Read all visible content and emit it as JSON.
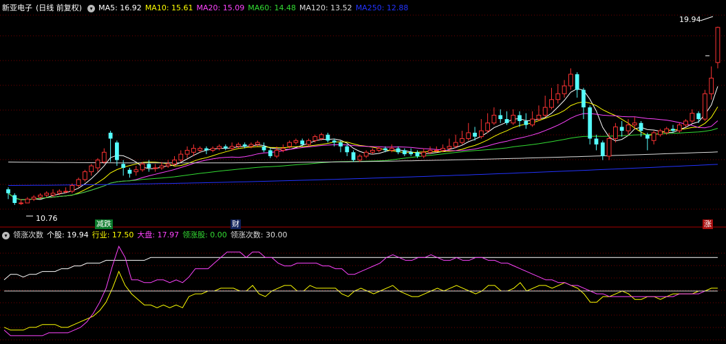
{
  "stock_name": "新亚电子",
  "period_label": "(日线 前复权)",
  "ma_legend": [
    {
      "label": "MA5: 16.92",
      "color": "#ffffff"
    },
    {
      "label": "MA10: 15.61",
      "color": "#ffff00"
    },
    {
      "label": "MA20: 15.09",
      "color": "#ff44ff"
    },
    {
      "label": "MA60: 14.48",
      "color": "#33dd33"
    },
    {
      "label": "MA120: 13.52",
      "color": "#dddddd"
    },
    {
      "label": "MA250: 12.88",
      "color": "#2233ff"
    }
  ],
  "indicator_legend": [
    {
      "label": "领涨次数",
      "color": "#dddddd"
    },
    {
      "label": "个股: 19.94",
      "color": "#ffffff"
    },
    {
      "label": "行业: 17.50",
      "color": "#ffff00"
    },
    {
      "label": "大盘: 17.97",
      "color": "#ff44ff"
    },
    {
      "label": "领涨股: 0.00",
      "color": "#33dd33"
    },
    {
      "label": "领涨次数: 30.00",
      "color": "#dddddd"
    }
  ],
  "markers": {
    "high": "19.94",
    "low": "10.76",
    "event1": "减跌",
    "event2": "财",
    "event3": "涨"
  },
  "colors": {
    "up": "#ff3333",
    "down": "#55ffff",
    "grid": "#7a0000"
  },
  "chart_data": [
    {
      "type": "candlestick",
      "ylim": [
        10.3,
        20.6
      ],
      "series": [
        {
          "name": "K",
          "ohlc": [
            [
              11.6,
              11.4,
              11.7,
              11.1
            ],
            [
              11.3,
              10.9,
              11.4,
              10.8
            ],
            [
              10.9,
              10.9,
              11.1,
              10.8
            ],
            [
              10.9,
              11.1,
              11.2,
              10.9
            ],
            [
              11.1,
              11.2,
              11.3,
              11.0
            ],
            [
              11.2,
              11.3,
              11.4,
              11.1
            ],
            [
              11.3,
              11.4,
              11.5,
              11.2
            ],
            [
              11.3,
              11.4,
              11.6,
              11.2
            ],
            [
              11.4,
              11.5,
              11.6,
              11.3
            ],
            [
              11.5,
              11.5,
              11.7,
              11.4
            ],
            [
              11.5,
              11.8,
              11.9,
              11.4
            ],
            [
              11.8,
              12.1,
              12.2,
              11.7
            ],
            [
              12.1,
              12.5,
              12.6,
              12.0
            ],
            [
              12.5,
              12.8,
              12.9,
              12.3
            ],
            [
              12.7,
              13.1,
              13.2,
              12.5
            ],
            [
              13.0,
              13.5,
              13.7,
              12.9
            ],
            [
              14.5,
              14.2,
              14.6,
              13.0
            ],
            [
              14.0,
              13.1,
              14.1,
              12.8
            ],
            [
              12.9,
              12.7,
              13.1,
              12.3
            ],
            [
              12.6,
              12.4,
              12.7,
              12.2
            ],
            [
              12.5,
              12.6,
              12.8,
              12.3
            ],
            [
              12.6,
              12.9,
              13.0,
              12.5
            ],
            [
              12.9,
              12.7,
              13.1,
              12.5
            ],
            [
              12.7,
              12.7,
              12.9,
              12.5
            ],
            [
              12.7,
              12.8,
              13.0,
              12.6
            ],
            [
              12.8,
              12.9,
              13.1,
              12.7
            ],
            [
              12.9,
              13.1,
              13.3,
              12.8
            ],
            [
              13.1,
              13.4,
              13.6,
              13.0
            ],
            [
              13.4,
              13.6,
              13.8,
              13.2
            ],
            [
              13.5,
              13.7,
              13.9,
              13.3
            ],
            [
              13.6,
              13.7,
              13.8,
              13.5
            ],
            [
              13.7,
              13.6,
              13.8,
              13.4
            ],
            [
              13.6,
              13.7,
              13.8,
              13.5
            ],
            [
              13.7,
              13.8,
              13.9,
              13.6
            ],
            [
              13.8,
              13.7,
              13.9,
              13.6
            ],
            [
              13.7,
              13.8,
              14.0,
              13.6
            ],
            [
              13.8,
              13.9,
              14.0,
              13.7
            ],
            [
              13.9,
              13.8,
              14.0,
              13.7
            ],
            [
              13.8,
              13.9,
              14.0,
              13.7
            ],
            [
              13.9,
              14.0,
              14.1,
              13.8
            ],
            [
              13.8,
              13.6,
              14.0,
              13.5
            ],
            [
              13.6,
              13.3,
              13.7,
              13.2
            ],
            [
              13.3,
              13.6,
              13.8,
              13.2
            ],
            [
              13.6,
              13.7,
              13.9,
              13.5
            ],
            [
              13.8,
              14.0,
              14.1,
              13.7
            ],
            [
              14.0,
              14.1,
              14.2,
              13.9
            ],
            [
              14.1,
              13.9,
              14.2,
              13.8
            ],
            [
              13.9,
              14.1,
              14.2,
              13.8
            ],
            [
              14.1,
              14.3,
              14.4,
              14.0
            ],
            [
              14.2,
              14.4,
              14.5,
              14.1
            ],
            [
              14.4,
              14.1,
              14.5,
              14.0
            ],
            [
              14.1,
              14.0,
              14.2,
              13.8
            ],
            [
              14.0,
              13.8,
              14.1,
              13.5
            ],
            [
              13.8,
              13.5,
              13.9,
              13.3
            ],
            [
              13.5,
              13.1,
              13.6,
              13.0
            ],
            [
              13.1,
              13.3,
              13.4,
              13.0
            ],
            [
              13.3,
              13.5,
              13.6,
              13.2
            ],
            [
              13.5,
              13.6,
              13.7,
              13.4
            ],
            [
              13.6,
              13.7,
              13.8,
              13.5
            ],
            [
              13.7,
              13.6,
              13.8,
              13.5
            ],
            [
              13.6,
              13.7,
              13.9,
              13.5
            ],
            [
              13.7,
              13.5,
              13.8,
              13.4
            ],
            [
              13.6,
              13.4,
              13.7,
              13.3
            ],
            [
              13.5,
              13.4,
              13.7,
              13.3
            ],
            [
              13.5,
              13.3,
              13.6,
              13.2
            ],
            [
              13.3,
              13.5,
              13.7,
              13.2
            ],
            [
              13.5,
              13.6,
              13.8,
              13.4
            ],
            [
              13.6,
              13.6,
              13.8,
              13.5
            ],
            [
              13.6,
              13.7,
              13.9,
              13.5
            ],
            [
              13.7,
              13.8,
              14.2,
              13.6
            ],
            [
              13.8,
              14.0,
              14.4,
              13.7
            ],
            [
              14.0,
              14.2,
              14.6,
              13.9
            ],
            [
              14.2,
              14.5,
              15.0,
              14.1
            ],
            [
              14.5,
              14.3,
              14.8,
              14.1
            ],
            [
              14.3,
              14.6,
              15.2,
              14.2
            ],
            [
              14.6,
              15.0,
              15.5,
              14.5
            ],
            [
              15.0,
              15.4,
              15.8,
              14.9
            ],
            [
              15.4,
              15.2,
              15.7,
              15.0
            ],
            [
              15.2,
              15.0,
              15.6,
              14.9
            ],
            [
              15.0,
              15.4,
              15.7,
              14.9
            ],
            [
              15.4,
              15.1,
              15.6,
              14.8
            ],
            [
              15.1,
              14.9,
              15.5,
              14.7
            ],
            [
              14.9,
              15.2,
              15.6,
              14.8
            ],
            [
              15.2,
              15.4,
              15.9,
              15.1
            ],
            [
              15.4,
              15.8,
              16.4,
              15.3
            ],
            [
              15.8,
              16.2,
              16.8,
              15.7
            ],
            [
              16.2,
              16.5,
              17.0,
              16.0
            ],
            [
              16.5,
              16.9,
              17.2,
              16.3
            ],
            [
              16.9,
              17.5,
              17.8,
              16.7
            ],
            [
              17.5,
              16.7,
              17.6,
              16.3
            ],
            [
              16.7,
              15.8,
              16.8,
              15.2
            ],
            [
              15.8,
              14.2,
              15.9,
              13.9
            ],
            [
              14.2,
              13.9,
              14.4,
              13.6
            ],
            [
              14.0,
              13.3,
              14.1,
              13.1
            ],
            [
              13.3,
              14.2,
              14.5,
              13.1
            ],
            [
              14.2,
              14.8,
              15.0,
              14.0
            ],
            [
              14.8,
              14.6,
              15.1,
              14.3
            ],
            [
              14.6,
              14.9,
              15.2,
              14.4
            ],
            [
              14.9,
              15.0,
              15.3,
              14.7
            ],
            [
              15.0,
              14.6,
              15.1,
              14.3
            ],
            [
              14.4,
              14.2,
              14.5,
              13.6
            ],
            [
              14.1,
              14.5,
              14.6,
              13.9
            ],
            [
              14.4,
              14.6,
              14.7,
              14.3
            ],
            [
              14.5,
              14.7,
              14.8,
              14.4
            ],
            [
              14.7,
              14.6,
              14.9,
              14.5
            ],
            [
              14.6,
              14.9,
              15.0,
              14.5
            ],
            [
              14.9,
              15.1,
              15.2,
              14.8
            ],
            [
              15.1,
              15.5,
              15.7,
              15.0
            ],
            [
              15.5,
              15.2,
              15.6,
              15.0
            ],
            [
              15.2,
              16.5,
              16.7,
              15.1
            ],
            [
              16.5,
              17.3,
              17.9,
              16.2
            ],
            [
              18.1,
              19.9,
              19.94,
              17.8
            ]
          ]
        }
      ],
      "ma_periods": [
        5,
        10,
        20,
        60,
        120,
        250
      ],
      "ma_values_last": [
        16.92,
        15.61,
        15.09,
        14.48,
        13.52,
        12.88
      ]
    },
    {
      "type": "line",
      "title": "领涨次数",
      "series": [
        {
          "name": "个股",
          "values": [
            22,
            24,
            24,
            23,
            24,
            24,
            25,
            25,
            25,
            26,
            26,
            27,
            27,
            28,
            28,
            28,
            29,
            29,
            29,
            29,
            29,
            29,
            29,
            30,
            30,
            30,
            30,
            30,
            30,
            30,
            30,
            30,
            30,
            30,
            30,
            30,
            30,
            30,
            30,
            30,
            30,
            30,
            30,
            30,
            30,
            30,
            30,
            30,
            30,
            30,
            30,
            30,
            30,
            30,
            30,
            30,
            30,
            30,
            30,
            30,
            30,
            30,
            30,
            30,
            30,
            30,
            30,
            30,
            30,
            30,
            30,
            30,
            30,
            30,
            30,
            30,
            30,
            30,
            30,
            30,
            30,
            30,
            30,
            30,
            30,
            30,
            30,
            30,
            30,
            30,
            30,
            30,
            30,
            30,
            30,
            30,
            30,
            30,
            30,
            30,
            30,
            30,
            30,
            30,
            30,
            30,
            30,
            30,
            30,
            30,
            30,
            30,
            30
          ]
        },
        {
          "name": "行业",
          "values": [
            5,
            4,
            4,
            4,
            5,
            5,
            6,
            6,
            6,
            5,
            5,
            6,
            7,
            8,
            9,
            11,
            14,
            19,
            25,
            20,
            17,
            15,
            13,
            13,
            12,
            13,
            12,
            13,
            12,
            16,
            17,
            17,
            18,
            18,
            19,
            19,
            19,
            18,
            18,
            20,
            17,
            16,
            18,
            19,
            20,
            20,
            18,
            18,
            20,
            19,
            19,
            19,
            19,
            17,
            16,
            18,
            19,
            18,
            17,
            18,
            19,
            20,
            18,
            17,
            16,
            16,
            17,
            18,
            19,
            18,
            19,
            20,
            19,
            18,
            17,
            18,
            20,
            20,
            18,
            18,
            19,
            21,
            18,
            19,
            20,
            20,
            19,
            20,
            21,
            20,
            19,
            17,
            14,
            14,
            16,
            16,
            17,
            18,
            17,
            15,
            15,
            16,
            16,
            15,
            16,
            17,
            17,
            17,
            17,
            18,
            18,
            19,
            19
          ]
        },
        {
          "name": "大盘",
          "values": [
            4,
            2,
            2,
            2,
            2,
            2,
            2,
            3,
            3,
            3,
            3,
            4,
            5,
            7,
            10,
            14,
            19,
            27,
            34,
            30,
            22,
            22,
            21,
            21,
            22,
            22,
            21,
            22,
            21,
            23,
            26,
            26,
            26,
            28,
            30,
            32,
            32,
            32,
            30,
            32,
            32,
            30,
            30,
            28,
            27,
            27,
            28,
            28,
            28,
            28,
            27,
            27,
            26,
            26,
            24,
            24,
            25,
            26,
            27,
            28,
            30,
            31,
            30,
            29,
            29,
            30,
            30,
            31,
            30,
            29,
            29,
            30,
            29,
            29,
            30,
            30,
            29,
            29,
            28,
            28,
            27,
            26,
            25,
            24,
            23,
            22,
            22,
            21,
            21,
            20,
            20,
            19,
            18,
            17,
            17,
            16,
            16,
            16,
            16,
            16,
            16,
            16,
            16,
            16,
            16,
            16,
            17,
            17,
            17,
            17,
            18,
            18,
            18
          ]
        }
      ]
    }
  ]
}
